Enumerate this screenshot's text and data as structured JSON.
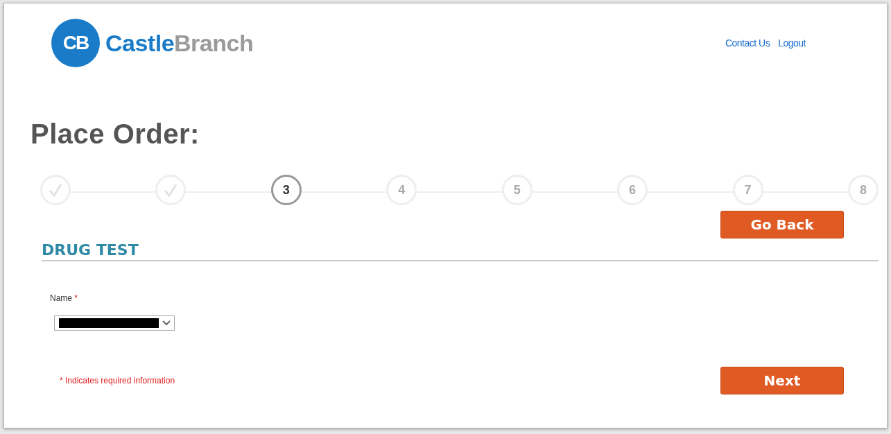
{
  "logo": {
    "mark": "CB",
    "name_part_1": "Castle",
    "name_part_2": "Branch"
  },
  "header_links": [
    "Contact Us",
    "Logout"
  ],
  "page_title": "Place Order:",
  "steps": [
    {
      "kind": "done"
    },
    {
      "kind": "done"
    },
    {
      "kind": "current",
      "label": "3"
    },
    {
      "kind": "upcoming",
      "label": "4"
    },
    {
      "kind": "upcoming",
      "label": "5"
    },
    {
      "kind": "upcoming",
      "label": "6"
    },
    {
      "kind": "upcoming",
      "label": "7"
    },
    {
      "kind": "upcoming",
      "label": "8"
    }
  ],
  "go_back_button": "Go Back",
  "section_title": "DRUG TEST",
  "name_field": {
    "label": "Name",
    "required_mark": "*",
    "redacted": true
  },
  "required_note": "* Indicates required information",
  "next_button": "Next"
}
